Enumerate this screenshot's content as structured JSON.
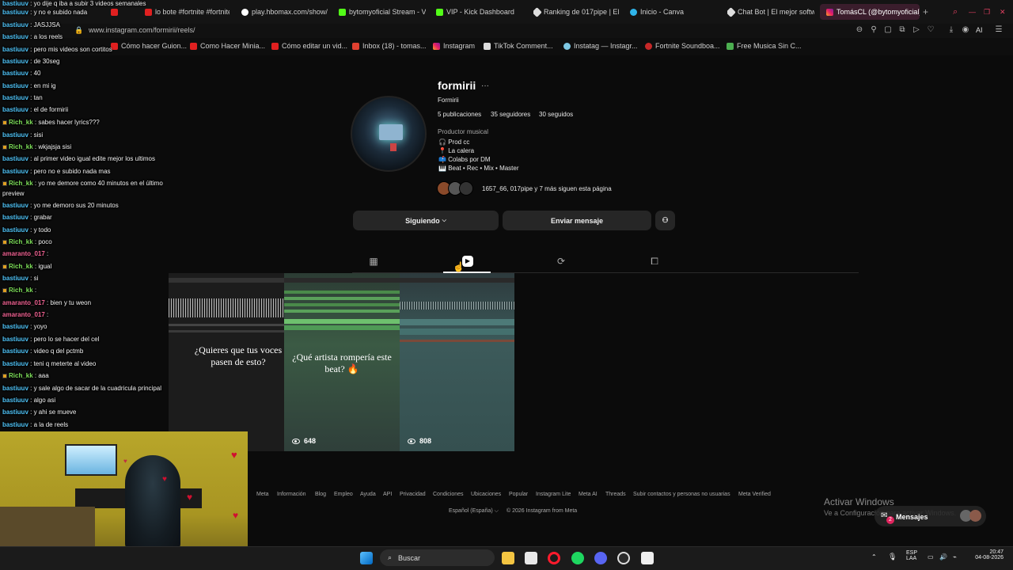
{
  "browser": {
    "tabs": [
      {
        "label": "yo dije q iba a subir 3 videos semanales"
      },
      {
        "label": "lo bote #fortnite #fortnite"
      },
      {
        "label": "play.hbomax.com/show/"
      },
      {
        "label": "bytomyoficial Stream - V"
      },
      {
        "label": "VIP - Kick Dashboard"
      },
      {
        "label": "Ranking de 017pipe | El m"
      },
      {
        "label": "Inicio - Canva"
      },
      {
        "label": "Chat Bot | El mejor softw"
      },
      {
        "label": "TomásCL (@bytomyoficial)"
      }
    ],
    "url": "www.instagram.com/formirii/reels/",
    "bookmarks": [
      {
        "label": "Cómo hacer Guion..."
      },
      {
        "label": "Como Hacer Minia..."
      },
      {
        "label": "Cómo editar un vid..."
      },
      {
        "label": "Inbox (18) - tomas..."
      },
      {
        "label": "Instagram"
      },
      {
        "label": "TikTok Comment..."
      },
      {
        "label": "Instatag — Instagr..."
      },
      {
        "label": "Fortnite Soundboa..."
      },
      {
        "label": "Free Musica Sin C..."
      }
    ],
    "ai_label": "AI"
  },
  "profile": {
    "username": "formirii",
    "more": "···",
    "full_name": "Formirii",
    "posts": "5 publicaciones",
    "followers": "35 seguidores",
    "following": "30 seguidos",
    "category": "Productor musical",
    "bio": [
      {
        "icon": "🎧",
        "text": "Prod cc"
      },
      {
        "icon": "📍",
        "text": "La calera"
      },
      {
        "icon": "📫",
        "text": "Colabs por DM"
      },
      {
        "icon": "🎹",
        "text": "Beat • Rec • Mix • Master"
      }
    ],
    "followed_by": "1657_66, 017pipe y 7 más siguen esta página",
    "following_button": "Siguiendo",
    "message_button": "Enviar mensaje"
  },
  "reels": [
    {
      "caption": "¿Quieres que tus voces pasen de esto?",
      "views": ""
    },
    {
      "caption": "¿Qué artista rompería este beat? 🔥",
      "views": "648"
    },
    {
      "caption": "",
      "views": "808"
    }
  ],
  "footer": {
    "links": [
      "Meta",
      "Información",
      "Blog",
      "Empleo",
      "Ayuda",
      "API",
      "Privacidad",
      "Condiciones",
      "Ubicaciones",
      "Popular",
      "Instagram Lite",
      "Meta AI",
      "Threads",
      "Subir contactos y personas no usuarias",
      "Meta Verified"
    ],
    "language": "Español (España)",
    "copyright": "© 2026 Instagram from Meta"
  },
  "messages_widget": {
    "label": "Mensajes",
    "badge": "2"
  },
  "watermark": {
    "line1": "Activar Windows",
    "line2": "Ve a Configuración para activar Windows."
  },
  "chat": [
    {
      "user": "bastiuuv",
      "text": "yo dije q iba a subir 3 videos semanales",
      "color": "#4fc3f7",
      "badge": false
    },
    {
      "user": "bastiuuv",
      "text": "y no e subido nada",
      "color": "#4fc3f7",
      "badge": false
    },
    {
      "user": "bastiuuv",
      "text": "JASJJSA",
      "color": "#4fc3f7",
      "badge": false
    },
    {
      "user": "bastiuuv",
      "text": "a los reels",
      "color": "#4fc3f7",
      "badge": false
    },
    {
      "user": "bastiuuv",
      "text": "pero mis videos son cortitos",
      "color": "#4fc3f7",
      "badge": false
    },
    {
      "user": "bastiuuv",
      "text": "de 30seg",
      "color": "#4fc3f7",
      "badge": false
    },
    {
      "user": "bastiuuv",
      "text": "40",
      "color": "#4fc3f7",
      "badge": false
    },
    {
      "user": "bastiuuv",
      "text": "en mi ig",
      "color": "#4fc3f7",
      "badge": false
    },
    {
      "user": "bastiuuv",
      "text": "tan",
      "color": "#4fc3f7",
      "badge": false
    },
    {
      "user": "bastiuuv",
      "text": "el de formirii",
      "color": "#4fc3f7",
      "badge": false
    },
    {
      "user": "Rich_kk",
      "text": "sabes hacer lyrics???",
      "color": "#7ee05a",
      "badge": true
    },
    {
      "user": "bastiuuv",
      "text": "sisi",
      "color": "#4fc3f7",
      "badge": false
    },
    {
      "user": "Rich_kk",
      "text": "wkjajsja sisi",
      "color": "#7ee05a",
      "badge": true
    },
    {
      "user": "bastiuuv",
      "text": "al primer video igual edite mejor los ultimos",
      "color": "#4fc3f7",
      "badge": false
    },
    {
      "user": "bastiuuv",
      "text": "pero no e subido nada mas",
      "color": "#4fc3f7",
      "badge": false
    },
    {
      "user": "Rich_kk",
      "text": "yo me demore como 40 minutos en el último",
      "color": "#7ee05a",
      "badge": true
    },
    {
      "user": "",
      "text": "preview",
      "color": "#4fc3f7",
      "badge": false
    },
    {
      "user": "bastiuuv",
      "text": "yo me demoro sus 20 minutos",
      "color": "#4fc3f7",
      "badge": false
    },
    {
      "user": "bastiuuv",
      "text": "grabar",
      "color": "#4fc3f7",
      "badge": false
    },
    {
      "user": "bastiuuv",
      "text": "y todo",
      "color": "#4fc3f7",
      "badge": false
    },
    {
      "user": "Rich_kk",
      "text": "poco",
      "color": "#7ee05a",
      "badge": true
    },
    {
      "user": "amaranto_017",
      "text": "",
      "color": "#f06292",
      "badge": false
    },
    {
      "user": "Rich_kk",
      "text": "igual",
      "color": "#7ee05a",
      "badge": true
    },
    {
      "user": "bastiuuv",
      "text": "si",
      "color": "#4fc3f7",
      "badge": false
    },
    {
      "user": "Rich_kk",
      "text": "",
      "color": "#7ee05a",
      "badge": true
    },
    {
      "user": "amaranto_017",
      "text": "bien y tu weon",
      "color": "#f06292",
      "badge": false
    },
    {
      "user": "amaranto_017",
      "text": "",
      "color": "#f06292",
      "badge": false
    },
    {
      "user": "bastiuuv",
      "text": "yoyo",
      "color": "#4fc3f7",
      "badge": false
    },
    {
      "user": "bastiuuv",
      "text": "pero lo se hacer del cel",
      "color": "#4fc3f7",
      "badge": false
    },
    {
      "user": "bastiuuv",
      "text": "video q del pctmb",
      "color": "#4fc3f7",
      "badge": false
    },
    {
      "user": "bastiuuv",
      "text": "teni q meterte al video",
      "color": "#4fc3f7",
      "badge": false
    },
    {
      "user": "Rich_kk",
      "text": "aaa",
      "color": "#7ee05a",
      "badge": true
    },
    {
      "user": "bastiuuv",
      "text": "y sale algo de sacar de la cuadricula principal",
      "color": "#4fc3f7",
      "badge": false
    },
    {
      "user": "bastiuuv",
      "text": "algo asi",
      "color": "#4fc3f7",
      "badge": false
    },
    {
      "user": "bastiuuv",
      "text": "y ahi se mueve",
      "color": "#4fc3f7",
      "badge": false
    },
    {
      "user": "bastiuuv",
      "text": "a la de reels",
      "color": "#4fc3f7",
      "badge": false
    }
  ],
  "taskbar": {
    "search_placeholder": "Buscar",
    "lang": "ESP",
    "lang2": "LAA",
    "time": "20:47",
    "date": "04-08-2026"
  },
  "colors": {
    "accent_tab": "#3a1d2c",
    "instagram_bg": "#0b0b0b",
    "button_bg": "#262626"
  }
}
